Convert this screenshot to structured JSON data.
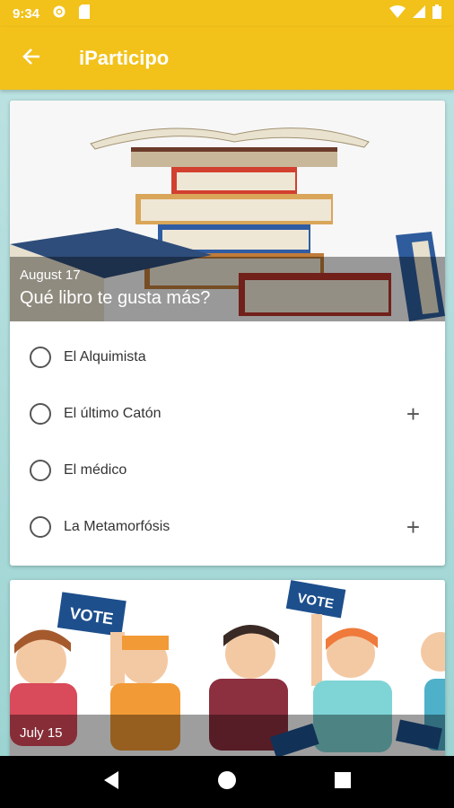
{
  "status_bar": {
    "time": "9:34",
    "icons": [
      "gear-icon",
      "sim-icon",
      "wifi-icon",
      "signal-icon",
      "battery-icon"
    ]
  },
  "app_bar": {
    "title": "iParticipo",
    "back_icon": "arrow-left-icon"
  },
  "polls": [
    {
      "date": "August 17",
      "question": "Qué libro te gusta más?",
      "options": [
        {
          "label": "El Alquimista",
          "has_plus": false
        },
        {
          "label": "El último Catón",
          "has_plus": true
        },
        {
          "label": "El médico",
          "has_plus": false
        },
        {
          "label": "La Metamorfósis",
          "has_plus": true
        }
      ]
    },
    {
      "date": "July 15",
      "sign_text": "VOTE"
    }
  ],
  "colors": {
    "accent": "#f2c21b",
    "background": "#a8d9d7"
  },
  "nav_bar": {
    "icons": [
      "back-triangle-icon",
      "home-circle-icon",
      "recents-square-icon"
    ]
  }
}
